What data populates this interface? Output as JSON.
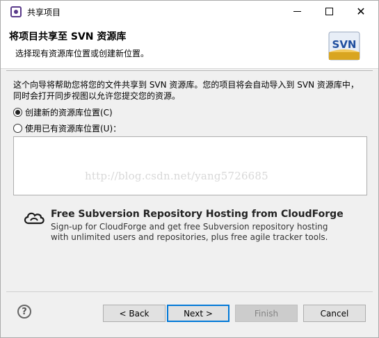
{
  "window": {
    "title": "共享项目"
  },
  "banner": {
    "heading": "将项目共享至 SVN 资源库",
    "subheading": "选择现有资源库位置或创建新位置。",
    "logo_text": "SVN"
  },
  "content": {
    "description_line1": "这个向导将帮助您将您的文件共享到 SVN 资源库。您的项目将会自动导入到 SVN 资源库中，",
    "description_line2": "同时会打开同步视图以允许您提交您的资源。",
    "radio_create": {
      "label": "创建新的资源库位置(C)",
      "checked": true
    },
    "radio_existing": {
      "label": "使用已有资源库位置(U)：",
      "checked": false
    },
    "watermark": "http://blog.csdn.net/yang5726685"
  },
  "cloudforge": {
    "title": "Free Subversion Repository Hosting from CloudForge",
    "line1": "Sign-up for CloudForge and get free Subversion repository hosting",
    "line2": "with unlimited users and repositories, plus free agile tracker tools."
  },
  "footer": {
    "help_symbol": "?",
    "back_label": "< Back",
    "next_label": "Next >",
    "finish_label": "Finish",
    "cancel_label": "Cancel"
  },
  "colors": {
    "accent": "#0078d7",
    "logo_blue": "#1f4e9e",
    "logo_gold": "#d9a520"
  }
}
